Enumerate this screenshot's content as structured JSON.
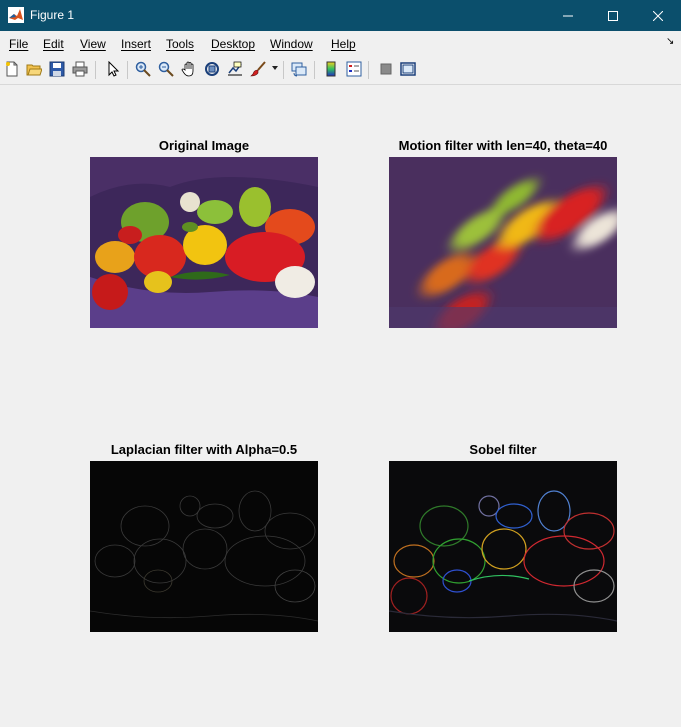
{
  "window": {
    "title": "Figure 1",
    "icon": "matlab-logo-icon",
    "controls": [
      "minimize-icon",
      "maximize-icon",
      "close-icon"
    ]
  },
  "menu": {
    "items": [
      "File",
      "Edit",
      "View",
      "Insert",
      "Tools",
      "Desktop",
      "Window",
      "Help"
    ],
    "dock_icon": "dock-arrow-icon"
  },
  "toolbar": {
    "buttons": [
      "new-figure-icon",
      "open-file-icon",
      "save-icon",
      "print-icon",
      "edit-plot-cursor-icon",
      "zoom-in-icon",
      "zoom-out-icon",
      "pan-icon",
      "rotate-3d-icon",
      "data-cursor-icon",
      "brush-icon",
      "link-plot-icon",
      "colorbar-icon",
      "legend-icon",
      "hide-plot-tools-icon",
      "show-plot-tools-icon"
    ]
  },
  "subplots": [
    {
      "title": "Original Image",
      "content": "peppers-original"
    },
    {
      "title": "Motion filter with len=40, theta=40",
      "content": "peppers-motion-blur"
    },
    {
      "title": "Laplacian filter with Alpha=0.5",
      "content": "peppers-laplacian"
    },
    {
      "title": "Sobel filter",
      "content": "peppers-sobel"
    }
  ]
}
